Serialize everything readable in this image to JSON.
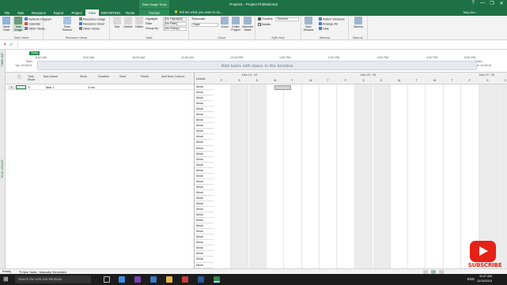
{
  "window": {
    "title": "Project1 - Project Professional",
    "context_tab_group": "Task Usage Tools",
    "tell_me": "Tell me what you want to do...",
    "user": "Toby Arn...",
    "controls": [
      "?",
      "—",
      "❐",
      "✕"
    ]
  },
  "tabs": [
    {
      "label": "File"
    },
    {
      "label": "Task"
    },
    {
      "label": "Resource"
    },
    {
      "label": "Report"
    },
    {
      "label": "Project"
    },
    {
      "label": "View"
    },
    {
      "label": "REPORTING"
    },
    {
      "label": "TEAM"
    },
    {
      "label": "Format"
    }
  ],
  "ribbon": {
    "task_views": {
      "label": "Task Views",
      "gantt": "Gantt Chart",
      "task_usage": "Task Usage",
      "network": "Network Diagram",
      "calendar": "Calendar",
      "other": "Other Views"
    },
    "resource_views": {
      "label": "Resource Views",
      "team_planner": "Team Planner",
      "resource_usage": "Resource Usage",
      "resource_sheet": "Resource Sheet",
      "other": "Other Views"
    },
    "data": {
      "label": "Data",
      "sort": "Sort",
      "outline": "Outline",
      "tables": "Tables",
      "highlight": "Highlight",
      "highlight_value": "[No Highlight]",
      "filter": "Filter",
      "filter_value": "[No Filter]",
      "group_by": "Group by:",
      "group_value": "[No Group]"
    },
    "zoom": {
      "label": "Zoom",
      "timescale": "Timescale:",
      "timescale_value": "Days",
      "zoom": "Zoom",
      "entire_project": "Entire Project",
      "selected_tasks": "Selected Tasks"
    },
    "split_view": {
      "label": "Split View",
      "timeline": "Timeline",
      "timeline_value": "Timeline",
      "details": "Details"
    },
    "window": {
      "label": "Window",
      "new_window": "New Window",
      "switch_windows": "Switch Windows",
      "arrange_all": "Arrange All",
      "hide": "Hide"
    },
    "macros": {
      "label": "Macros",
      "macros": "Macros"
    }
  },
  "timeline": {
    "side_label": "TIMELINE",
    "today": "Today",
    "start_label": "Start",
    "start_date": "Tue 12/15/15",
    "finish_label": "Finish",
    "finish_date": "Tue 12/15/15",
    "placeholder": "Add tasks with dates to the timeline",
    "ticks": [
      "8:00 AM",
      "9:00 AM",
      "10:00 AM",
      "11:00 AM",
      "12:00 PM",
      "1:00 PM",
      "2:00 PM",
      "3:00 PM",
      "4:00 PM",
      "5:00 PM"
    ]
  },
  "view_side_label": "TASK USAGE",
  "grid": {
    "columns": [
      "Task Mode",
      "Task Name",
      "Work",
      "Duration",
      "Start",
      "Finish",
      "Add New Column"
    ],
    "rows": [
      {
        "id": "1",
        "name": "Task 1",
        "work": "0 hrs"
      }
    ]
  },
  "usage": {
    "details_header": "Details",
    "weeks": [
      "Dec 13, '15",
      "Dec 20, '15",
      "Dec 27, '15"
    ],
    "days": [
      "F",
      "S",
      "S",
      "M",
      "T",
      "W",
      "T",
      "F",
      "S",
      "S",
      "M",
      "T",
      "W",
      "T",
      "F",
      "S",
      "S"
    ],
    "row_label": "Work",
    "row_count": 33
  },
  "status": {
    "ready": "Ready",
    "new_tasks": "New Tasks : Manually Scheduled",
    "tooltip": "Task Usage"
  },
  "taskbar": {
    "search": "Search the web and Windows",
    "time": "11:47 AM",
    "date": "12/15/2015",
    "lang": "ENG"
  },
  "overlay": {
    "subscribe": "SUBSCRIBE"
  },
  "colors": {
    "brand": "#1e7145",
    "subscribe": "#e62117"
  }
}
